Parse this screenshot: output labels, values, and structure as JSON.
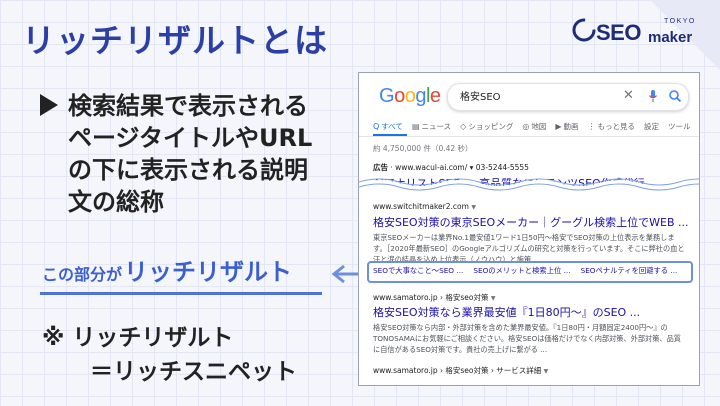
{
  "slide": {
    "title": "リッチリザルトとは",
    "bullet_text": "検索結果で表示されるページタイトルやURLの下に表示される説明文の総称",
    "pointer_prefix": "この部分が",
    "pointer_emphasis": "リッチリザルト",
    "note_line1": "※ リッチリザルト",
    "note_line2": "＝リッチスニペット"
  },
  "logo": {
    "seo": "SEO",
    "maker": "maker",
    "tokyo": "TOKYO"
  },
  "serp": {
    "google_letters": [
      "G",
      "o",
      "o",
      "g",
      "l",
      "e"
    ],
    "query": "格安SEO",
    "clear_glyph": "✕",
    "tabs": [
      {
        "label": "すべて",
        "icon": "Q"
      },
      {
        "label": "ニュース",
        "icon": "▤"
      },
      {
        "label": "ショッピング",
        "icon": "◇"
      },
      {
        "label": "地図",
        "icon": "◎"
      },
      {
        "label": "動画",
        "icon": "▶"
      },
      {
        "label": "もっと見る",
        "icon": "⋮"
      },
      {
        "label": "設定",
        "icon": ""
      },
      {
        "label": "ツール",
        "icon": ""
      }
    ],
    "result_count": "約 4,750,000 件（0.42 秒）",
    "ad": {
      "label": "広告",
      "url": " · www.wacul-ai.com/ ▾  03-5244-5555",
      "title": "AIアナリストSEO ・ 高品質なコンテンツSEO作成代行"
    },
    "result1": {
      "url": "www.switchitmaker2.com",
      "title": "格安SEO対策の東京SEOメーカー｜グーグル検索上位でWEB ...",
      "desc": "東京SEOメーカーは業界No.1最安値1ワード1日50円〜格安でSEO対策の上位表示を業務します。［2020年最新SEO］のGoogleアルゴリズムの研究と対策を行っています。そこに弊社の血と汗と涙の結晶を込め上位表示（ノウハウ）と施策",
      "rich_links": [
        "SEOで大事なこと〜SEO ...",
        "SEOのメリットと検索上位 ...",
        "SEOペナルティを回避する ..."
      ]
    },
    "result2": {
      "url": "www.samatoro.jp › 格安seo対策",
      "title": "格安SEO対策なら業界最安値『1日80円〜』のSEO ...",
      "desc": "格安SEO対策なら内部・外部対策を含めた業界最安値。『1日80円・月額固定2400円〜』のTONOSAMAにお気軽にご相談ください。格安SEOは価格だけでなく内部対策、外部対策、品質に自信があるSEO対策です。貴社の売上げに繋がる ..."
    },
    "result3": {
      "url": "www.samatoro.jp › 格安seo対策 › サービス詳細"
    }
  }
}
